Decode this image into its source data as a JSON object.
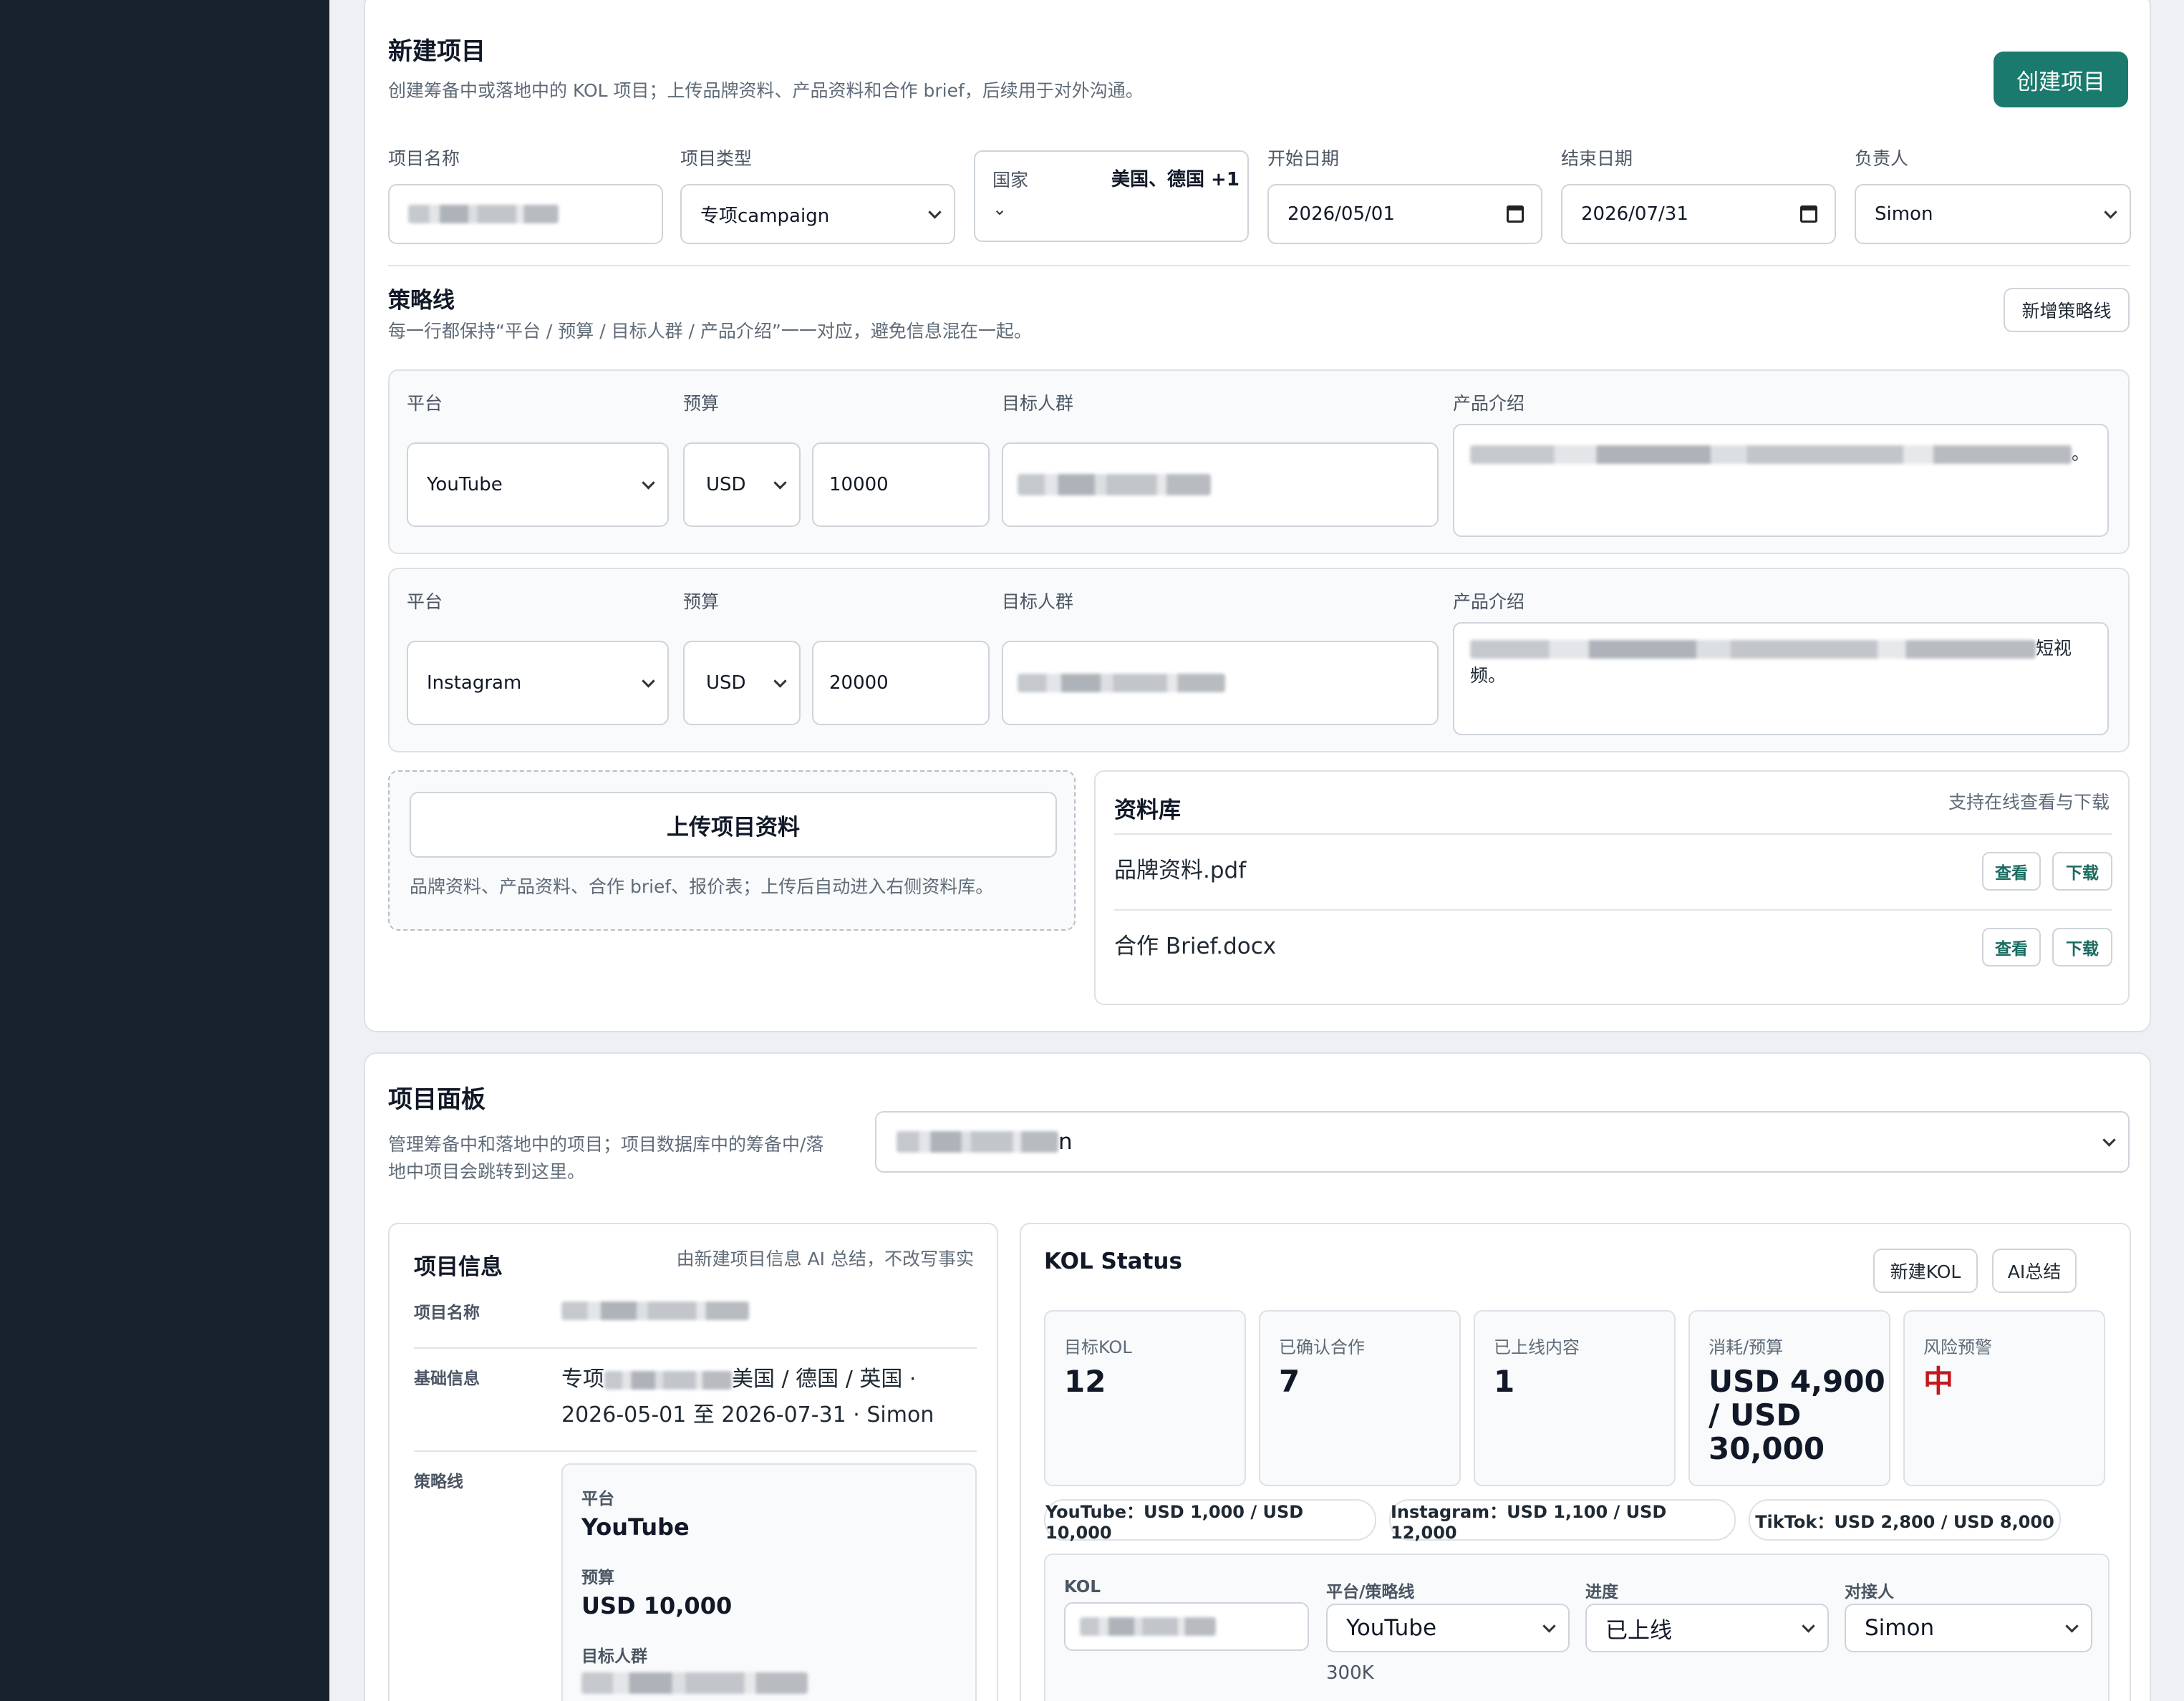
{
  "new_project": {
    "title": "新建项目",
    "subtitle": "创建筹备中或落地中的 KOL 项目；上传品牌资料、产品资料和合作 brief，后续用于对外沟通。",
    "create_button": "创建项目",
    "fields": {
      "name_label": "项目名称",
      "type_label": "项目类型",
      "type_value": "专项campaign",
      "country_label": "国家",
      "country_value": "美国、德国 +1",
      "country_caret": "⌄",
      "start_label": "开始日期",
      "start_value": "2026/05/01",
      "end_label": "结束日期",
      "end_value": "2026/07/31",
      "owner_label": "负责人",
      "owner_value": "Simon"
    },
    "strategy": {
      "title": "策略线",
      "subtitle": "每一行都保持“平台 / 预算 / 目标人群 / 产品介绍”一一对应，避免信息混在一起。",
      "add_button": "新增策略线",
      "labels": {
        "platform": "平台",
        "budget": "预算",
        "audience": "目标人群",
        "intro": "产品介绍"
      },
      "rows": [
        {
          "platform": "YouTube",
          "currency": "USD",
          "amount": "10000",
          "intro_tail": "。",
          "intro_tail2": ""
        },
        {
          "platform": "Instagram",
          "currency": "USD",
          "amount": "20000",
          "intro_tail": "短视",
          "intro_tail2": "频。"
        }
      ]
    },
    "upload": {
      "button": "上传项目资料",
      "hint": "品牌资料、产品资料、合作 brief、报价表；上传后自动进入右侧资料库。"
    },
    "library": {
      "title": "资料库",
      "note": "支持在线查看与下载",
      "view": "查看",
      "download": "下载",
      "files": [
        "品牌资料.pdf",
        "合作 Brief.docx"
      ]
    }
  },
  "dashboard": {
    "title": "项目面板",
    "subtitle_line1": "管理筹备中和落地中的项目；项目数据库中的筹备中/落",
    "subtitle_line2": "地中项目会跳转到这里。",
    "select_tail": "n",
    "info": {
      "title": "项目信息",
      "note": "由新建项目信息 AI 总结，不改写事实",
      "name_label": "项目名称",
      "basic_label": "基础信息",
      "basic_head": "专项",
      "basic_tail": "美国 / 德国 / 英国 ·",
      "basic_line2": "2026-05-01 至 2026-07-31 · Simon",
      "strategy_label": "策略线",
      "s_platform_label": "平台",
      "s_platform": "YouTube",
      "s_budget_label": "预算",
      "s_budget": "USD 10,000",
      "s_audience_label": "目标人群"
    },
    "kol": {
      "title": "KOL Status",
      "new_button": "新建KOL",
      "ai_button": "AI总结",
      "stats": [
        {
          "label": "目标KOL",
          "value": "12"
        },
        {
          "label": "已确认合作",
          "value": "7"
        },
        {
          "label": "已上线内容",
          "value": "1"
        },
        {
          "label": "消耗/预算",
          "value": "USD 4,900 / USD 30,000"
        },
        {
          "label": "风险预警",
          "value": "中"
        }
      ],
      "budgets": [
        "YouTube：USD 1,000 / USD 10,000",
        "Instagram：USD 1,100 / USD 12,000",
        "TikTok：USD 2,800 / USD 8,000"
      ],
      "table": {
        "col_kol": "KOL",
        "col_platform": "平台/策略线",
        "col_progress": "进度",
        "col_contact": "对接人",
        "platform": "YouTube",
        "followers": "300K",
        "progress": "已上线",
        "contact": "Simon"
      }
    }
  },
  "colors": {
    "accent": "#1a7a6d",
    "sidebar": "#17222d",
    "risk": "#c0191e"
  }
}
